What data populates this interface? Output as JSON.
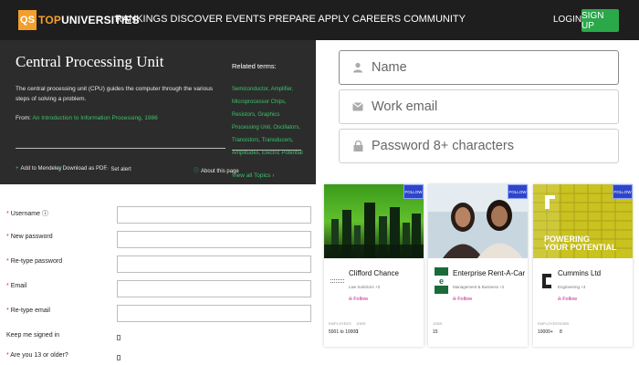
{
  "nav": {
    "logo_badge": "QS",
    "logo_top": "TOP",
    "logo_universities": "UNIVERSITIES",
    "links": [
      "RANKINGS",
      "DISCOVER",
      "EVENTS",
      "PREPARE",
      "APPLY",
      "CAREERS",
      "COMMUNITY"
    ],
    "login": "LOGIN",
    "signup": "SIGN UP"
  },
  "cpu_panel": {
    "title": "Central Processing Unit",
    "description": "The central processing unit (CPU) guides the computer through the various steps of solving a problem.",
    "from_label": "From:",
    "from_link": "An Introduction to Information Processing, 1986",
    "related_title": "Related terms:",
    "related_terms": "Semiconductor, Amplifier, Microprocessor Chips, Resistors, Graphics Processing Unit, Oscillators, Transistors, Transducers, Amplitudes, Electric Potential",
    "view_topics": "View all Topics",
    "actions": {
      "mendeley": "Add to Mendeley",
      "pdf": "Download as PDF",
      "alert": "Set alert",
      "about": "About this page"
    }
  },
  "reg_form": {
    "username": "Username",
    "new_password": "New password",
    "retype_password": "Re-type password",
    "email": "Email",
    "retype_email": "Re-type email",
    "keep_signed": "Keep me signed in",
    "age_check": "Are you 13 or older?"
  },
  "signup_form": {
    "name_placeholder": "Name",
    "email_placeholder": "Work email",
    "password_placeholder": "Password 8+ characters"
  },
  "cards": [
    {
      "badge": "FOLLOW",
      "name": "Clifford Chance",
      "category": "Law Solicitors +3",
      "follow": "Follow",
      "stat1_label": "EMPLOYEES",
      "stat1_value": "5001 to 10000",
      "stat2_label": "JOBS",
      "stat2_value": "1"
    },
    {
      "badge": "FOLLOW",
      "name": "Enterprise Rent-A-Car",
      "category": "Management & Business +2",
      "follow": "Follow",
      "stat1_label": "JOBS",
      "stat1_value": "15"
    },
    {
      "badge": "FOLLOW",
      "name": "Cummins Ltd",
      "category": "Engineering +3",
      "follow": "Follow",
      "banner_line1": "POWERING",
      "banner_line2": "YOUR POTENTIAL",
      "stat1_label": "EMPLOYEES",
      "stat1_value": "10000+",
      "stat2_label": "JOBS",
      "stat2_value": "8"
    }
  ],
  "colors": {
    "nav_bg": "#1e1e1e",
    "brand_orange": "#f29f2d",
    "signup_green": "#2aa84a",
    "panel_bg": "#2c2c2c",
    "link_green": "#3cc36a",
    "follow_magenta": "#c21c8e",
    "badge_blue": "#2e45c9"
  }
}
